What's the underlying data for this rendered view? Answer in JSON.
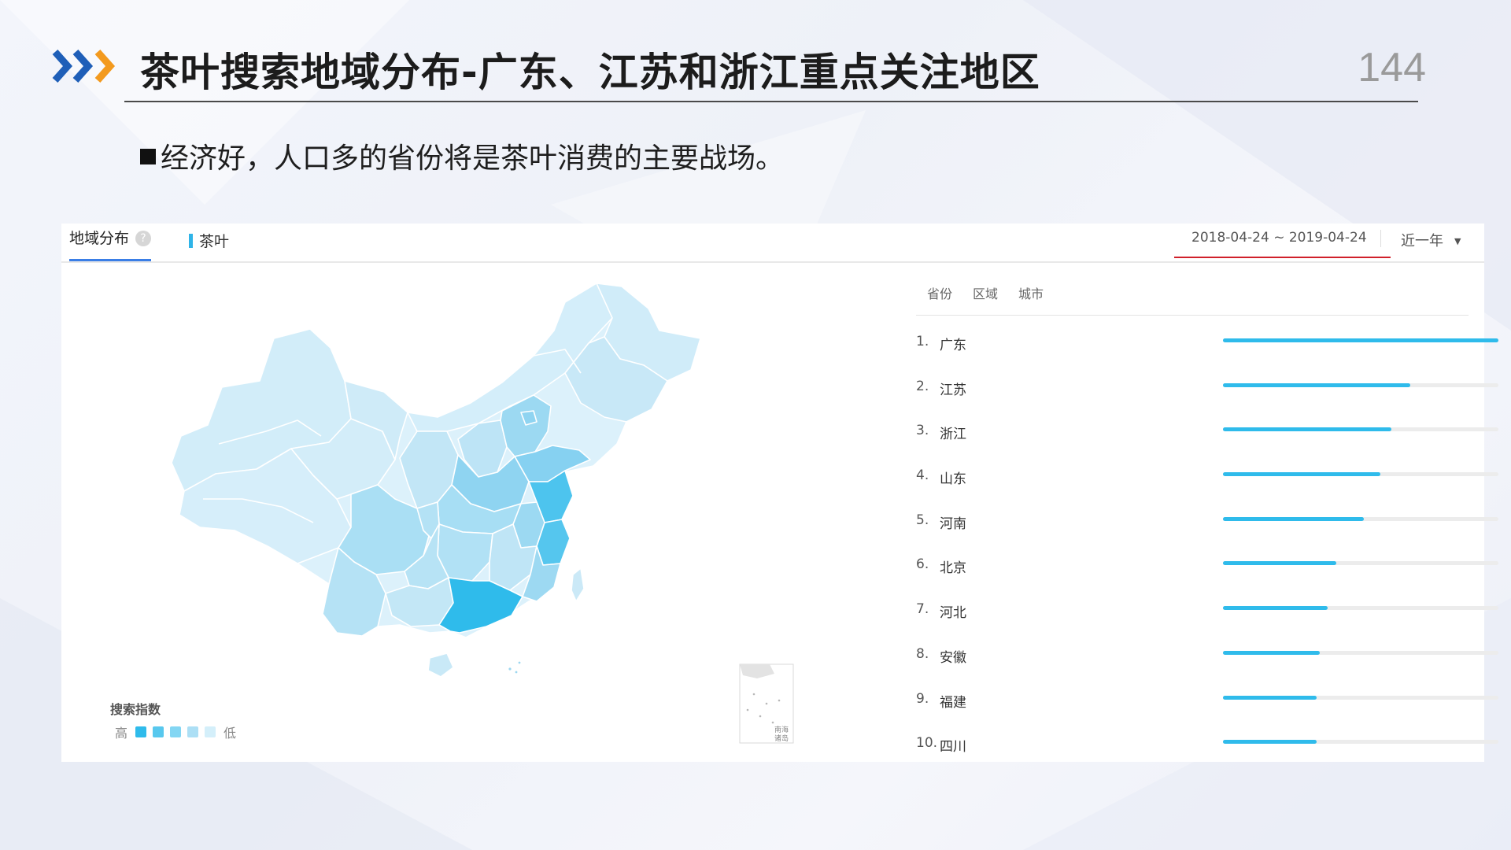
{
  "slide": {
    "title": "茶叶搜索地域分布-广东、江苏和浙江重点关注地区",
    "page_number": "144",
    "bullet": "经济好，人口多的省份将是茶叶消费的主要战场。"
  },
  "panel": {
    "tab_label": "地域分布",
    "help_icon": "question-circle-icon",
    "keyword": "茶叶",
    "date_range": "2018-04-24 ~ 2019-04-24",
    "period": "近一年",
    "rank_tabs": [
      "省份",
      "区域",
      "城市"
    ],
    "legend": {
      "title": "搜索指数",
      "high": "高",
      "low": "低",
      "colors": [
        "#2fbbeb",
        "#58c8ee",
        "#83d6f3",
        "#acdff5",
        "#d4effa"
      ]
    },
    "map_inset_labels": [
      "南海",
      "诸岛"
    ],
    "ranking": [
      {
        "num": "1.",
        "name": "广东",
        "value": 1.0
      },
      {
        "num": "2.",
        "name": "江苏",
        "value": 0.68
      },
      {
        "num": "3.",
        "name": "浙江",
        "value": 0.61
      },
      {
        "num": "4.",
        "name": "山东",
        "value": 0.57
      },
      {
        "num": "5.",
        "name": "河南",
        "value": 0.51
      },
      {
        "num": "6.",
        "name": "北京",
        "value": 0.41
      },
      {
        "num": "7.",
        "name": "河北",
        "value": 0.38
      },
      {
        "num": "8.",
        "name": "安徽",
        "value": 0.35
      },
      {
        "num": "9.",
        "name": "福建",
        "value": 0.34
      },
      {
        "num": "10.",
        "name": "四川",
        "value": 0.34
      }
    ],
    "colors": {
      "accent_blue": "#3a7ee6",
      "bar": "#2fbbeb",
      "date_underline": "#d0202a",
      "chevron_blue": "#1f5fb8",
      "chevron_orange": "#f39a1e"
    }
  }
}
